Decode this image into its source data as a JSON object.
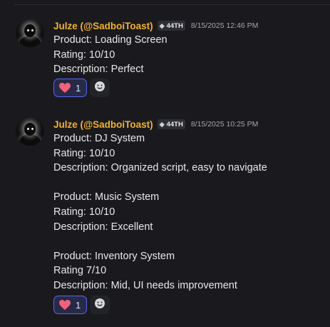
{
  "messages": [
    {
      "username": "Julze (@SadboiToast)",
      "badge": "44TH",
      "timestamp": "8/15/2025 12:46 PM",
      "lines": [
        "Product: Loading Screen",
        "Rating: 10/10",
        "Description: Perfect"
      ],
      "reaction_count": "1"
    },
    {
      "username": "Julze (@SadboiToast)",
      "badge": "44TH",
      "timestamp": "8/15/2025 10:25 PM",
      "lines": [
        "Product: DJ System",
        "Rating: 10/10",
        "Description: Organized script, easy to navigate",
        "",
        "Product: Music System",
        "Rating: 10/10",
        "Description: Excellent",
        "",
        "Product: Inventory System",
        "Rating 7/10",
        "Description: Mid, UI needs improvement"
      ],
      "reaction_count": "1"
    }
  ],
  "icons": {
    "reaction": "heart-icon",
    "add_reaction": "smiley-icon",
    "badge": "tag-icon"
  },
  "colors": {
    "username": "#f0b232",
    "reaction_border": "#5865f2",
    "heart": "#f2607a"
  }
}
